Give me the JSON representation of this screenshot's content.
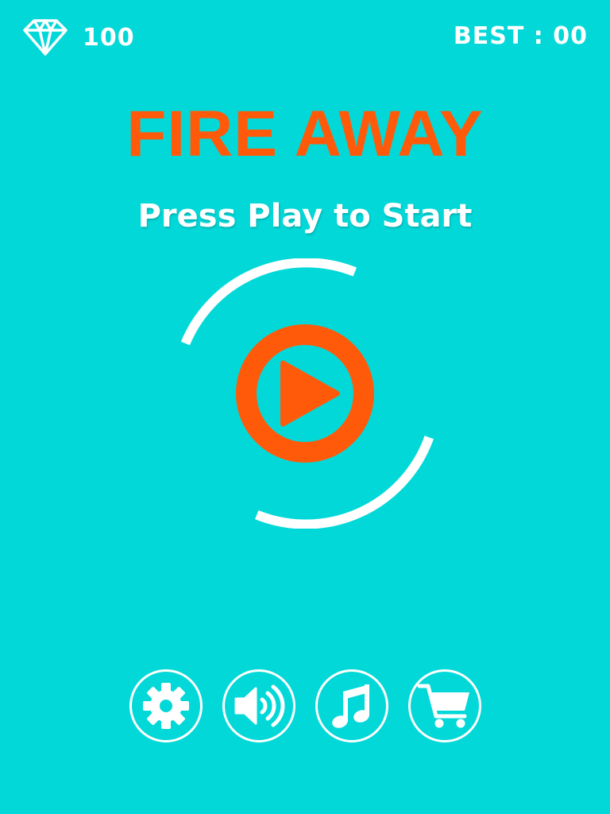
{
  "hud": {
    "gem_count": "100",
    "gem_icon": "diamond-icon",
    "best_label": "BEST : 00"
  },
  "title": "FIRE AWAY",
  "subtitle": "Press Play to Start",
  "play": {
    "icon": "play-icon"
  },
  "buttons": [
    {
      "name": "settings",
      "icon": "gear-icon"
    },
    {
      "name": "sound",
      "icon": "speaker-icon"
    },
    {
      "name": "music",
      "icon": "music-note-icon"
    },
    {
      "name": "shop",
      "icon": "cart-icon"
    }
  ],
  "colors": {
    "background": "#03D8D8",
    "accent": "#FF5A0A",
    "foreground": "#FFFFFF"
  }
}
